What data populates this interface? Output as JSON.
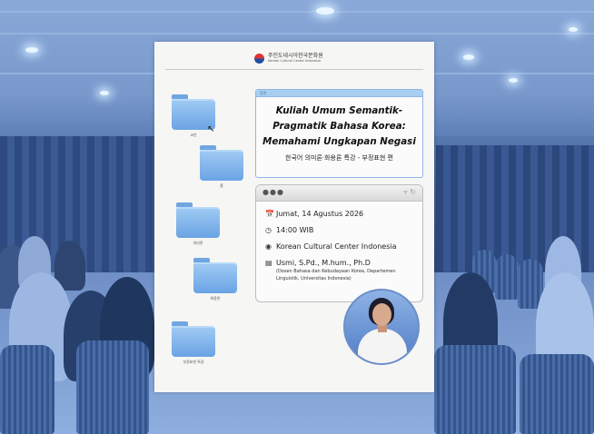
{
  "header": {
    "logo_ko": "주인도네시아한국문화원",
    "logo_en": "Korean Cultural Center Indonesia"
  },
  "desktop_folders": [
    {
      "label": "교안"
    },
    {
      "label": "홈"
    },
    {
      "label": "의미론"
    },
    {
      "label": "화용론"
    },
    {
      "label": "부정표현 특강"
    }
  ],
  "title_window": {
    "bar_label": "강연",
    "title_line1": "Kuliah Umum Semantik-",
    "title_line2": "Pragmatik Bahasa Korea:",
    "title_line3": "Memahami Ungkapan Negasi",
    "subtitle": "한국어 의미론·화용론 특강 - 부정표현 편"
  },
  "info_window": {
    "date": "Jumat, 14 Agustus 2026",
    "time": "14:00 WIB",
    "venue": "Korean Cultural Center Indonesia",
    "speaker": "Usmi, S.Pd., M.hum., Ph.D",
    "speaker_note": "(Dosen Bahasa dan Kebudayaan Korea, Departemen Linguistik, Universitas Indonesia)"
  },
  "icons": {
    "calendar": "calendar-icon",
    "clock": "clock-icon",
    "pin": "location-pin-icon",
    "id_card": "id-card-icon",
    "share": "share-icon",
    "refresh": "refresh-icon"
  },
  "colors": {
    "background_tint": "#5a7fb6",
    "poster": "#f6f6f4",
    "folder": "#7fb2ea",
    "title_bar": "#a8cff2"
  }
}
